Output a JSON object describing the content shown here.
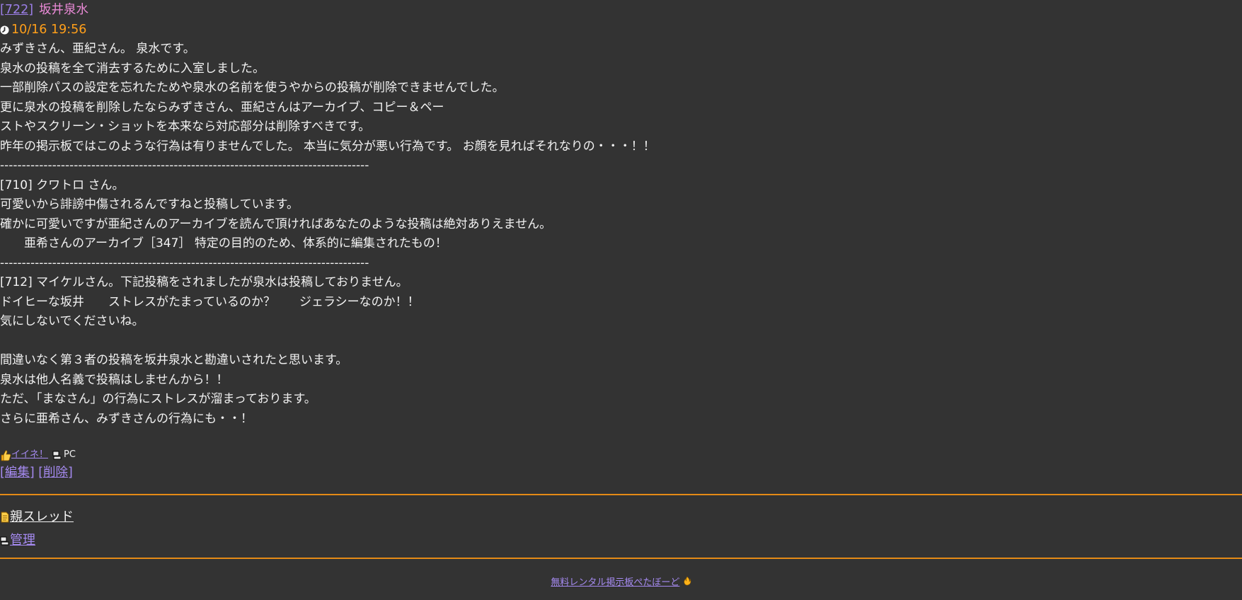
{
  "post": {
    "number": "[722]",
    "author": "坂井泉水",
    "date": "10/16 19:56",
    "lines": [
      "みずきさん、亜紀さん。 泉水です。",
      "泉水の投稿を全て消去するために入室しました。",
      "一部削除パスの設定を忘れたためや泉水の名前を使うやからの投稿が削除できませんでした。",
      "更に泉水の投稿を削除したならみずきさん、亜紀さんはアーカイブ、コピー＆ペー",
      "ストやスクリーン・ショットを本来なら対応部分は削除すべきです。",
      "昨年の掲示板ではこのような行為は有りませんでした。 本当に気分が悪い行為です。 お顔を見ればそれなりの・・・！！",
      "-------------------------------------------------------------------------------------",
      "[710] クワトロ さん。",
      "可愛いから誹謗中傷されるんですねと投稿しています。",
      "確かに可愛いですが亜紀さんのアーカイブを読んで頂ければあなたのような投稿は絶対ありえません。",
      "　　亜希さんのアーカイブ［347］ 特定の目的のため、体系的に編集されたもの！",
      "-------------------------------------------------------------------------------------",
      "[712] マイケルさん。下記投稿をされましたが泉水は投稿しておりません。",
      "ドイヒーな坂井　　ストレスがたまっているのか？　　ジェラシーなのか！！",
      "気にしないでくださいね。",
      "",
      "間違いなく第３者の投稿を坂井泉水と勘違いされたと思います。",
      "泉水は他人名義で投稿はしませんから！！",
      "ただ､「まなさん」の行為にストレスが溜まっております。",
      "さらに亜希さん、みずきさんの行為にも・・！"
    ],
    "like_label": "イイネ！",
    "device_label": "PC",
    "edit_label": "[編集]",
    "delete_label": "[削除]"
  },
  "nav": {
    "parent_thread_label": "親スレッド",
    "admin_label": "管理"
  },
  "footer": {
    "link_label": "無料レンタル掲示板ぺたぼーど"
  },
  "colors": {
    "background": "#333333",
    "text": "#f2f2f2",
    "link": "#a58af0",
    "author": "#e98ad6",
    "date": "#ff9f1a",
    "rule": "#e48a16"
  },
  "icons": [
    "clock-icon",
    "thumbs-up-icon",
    "pc-icon",
    "document-icon",
    "fire-icon"
  ]
}
